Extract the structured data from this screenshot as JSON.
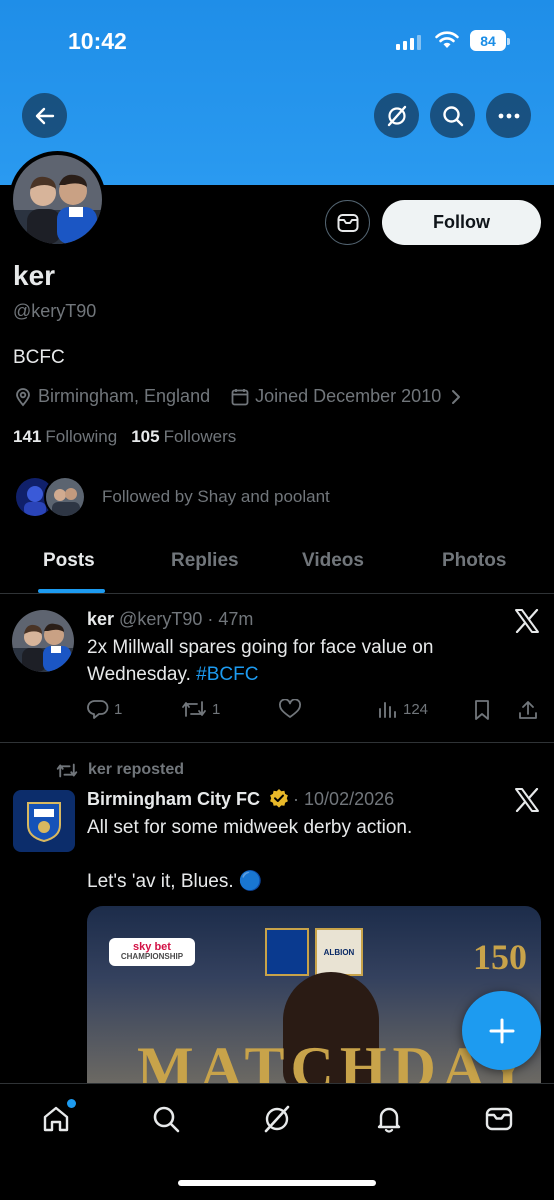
{
  "status_bar": {
    "time": "10:42",
    "battery": "84"
  },
  "profile": {
    "name": "ker",
    "handle": "@keryT90",
    "bio": "BCFC",
    "location": "Birmingham, England",
    "joined": "Joined December 2010",
    "following_count": "141",
    "following_label": "Following",
    "followers_count": "105",
    "followers_label": "Followers",
    "followed_by": "Followed by Shay and poolant",
    "follow_label": "Follow"
  },
  "tabs": [
    "Posts",
    "Replies",
    "Videos",
    "Photos"
  ],
  "posts": [
    {
      "author": "ker",
      "handle": "@keryT90",
      "time": "47m",
      "text_before": "2x Millwall spares going for face value on Wednesday. ",
      "hashtag": "#BCFC",
      "replies": "1",
      "reposts": "1",
      "views": "124"
    },
    {
      "repost_by": "ker reposted",
      "author": "Birmingham City FC",
      "date": "10/02/2026",
      "text_line1": "All set for some midweek derby action.",
      "text_line2": "Let's 'av it, Blues. 🔵",
      "media": {
        "sky_line1": "sky bet",
        "sky_line2": "CHAMPIONSHIP",
        "opponent_label": "ALBION",
        "anniversary": "150",
        "headline": "MATCHDAY"
      }
    }
  ],
  "colors": {
    "accent": "#1d9bf0",
    "banner": "#2a9af0",
    "muted": "#71767b"
  }
}
